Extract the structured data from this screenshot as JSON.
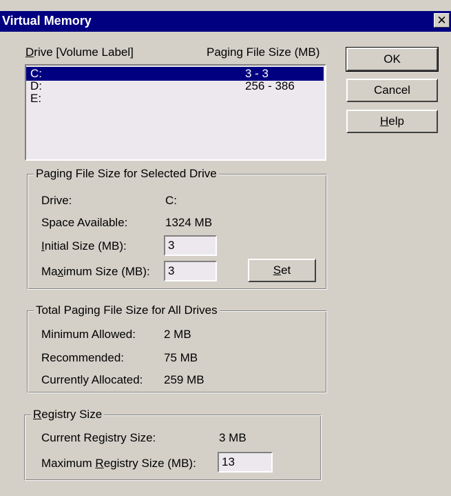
{
  "window": {
    "title": "Virtual Memory",
    "close_glyph": "✕"
  },
  "drives": {
    "header_drive_prefix": "D",
    "header_drive_rest": "rive  [Volume Label]",
    "header_size": "Paging File Size (MB)",
    "rows": [
      {
        "drive": "C:",
        "size": "3 - 3",
        "selected": true
      },
      {
        "drive": "D:",
        "size": "256 - 386",
        "selected": false
      },
      {
        "drive": "E:",
        "size": "",
        "selected": false
      }
    ]
  },
  "buttons": {
    "ok": "OK",
    "cancel": "Cancel",
    "help_prefix": "H",
    "help_rest": "elp",
    "set_prefix": "S",
    "set_rest": "et"
  },
  "selected_drive": {
    "legend": "Paging File Size for Selected Drive",
    "drive_label": "Drive:",
    "drive_value": "C:",
    "space_label": "Space Available:",
    "space_value": "1324 MB",
    "initial_prefix": "I",
    "initial_rest": "nitial Size (MB):",
    "initial_value": "3",
    "max_a": "Ma",
    "max_u": "x",
    "max_b": "imum Size (MB):",
    "max_value": "3"
  },
  "totals": {
    "legend": "Total Paging File Size for All Drives",
    "min_label": "Minimum Allowed:",
    "min_value": "2 MB",
    "rec_label": "Recommended:",
    "rec_value": "75 MB",
    "alloc_label": "Currently Allocated:",
    "alloc_value": "259 MB"
  },
  "registry": {
    "legend_prefix": "R",
    "legend_rest": "egistry Size",
    "current_label": "Current Registry Size:",
    "current_value": "3 MB",
    "max_a": "Maximum ",
    "max_u": "R",
    "max_b": "egistry Size (MB):",
    "max_value": "13"
  }
}
